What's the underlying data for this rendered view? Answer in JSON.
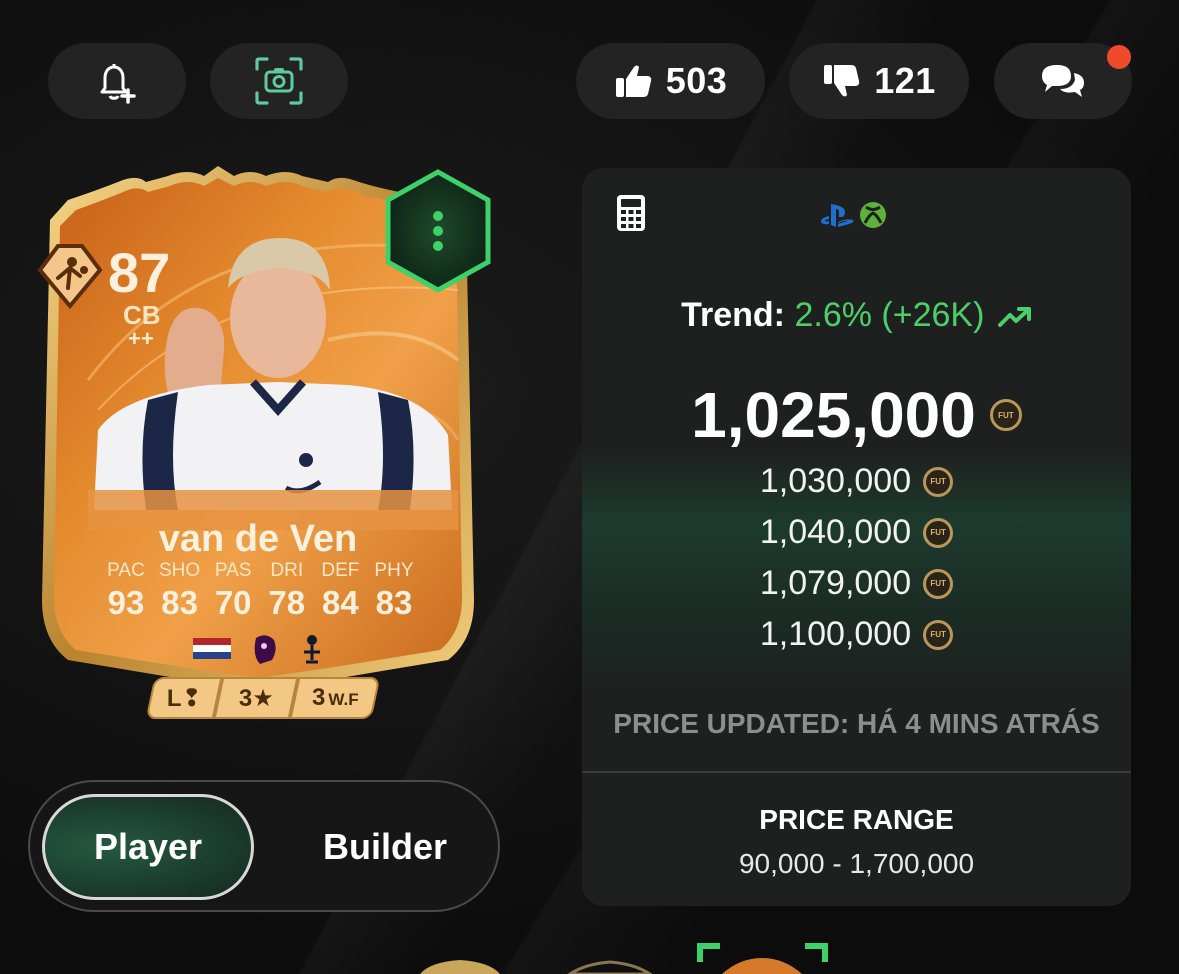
{
  "top_bar": {
    "likes": "503",
    "dislikes": "121",
    "icons": {
      "bell": "bell-plus-icon",
      "camera": "screenshot-camera-icon",
      "like": "thumbs-up-icon",
      "dislike": "thumbs-down-icon",
      "chat": "chat-bubbles-icon"
    },
    "notification_color": "#ef4a2a"
  },
  "card": {
    "rating": "87",
    "position": "CB",
    "position_plus": "++",
    "name": "van de Ven",
    "stat_labels": [
      "PAC",
      "SHO",
      "PAS",
      "DRI",
      "DEF",
      "PHY"
    ],
    "stat_values": [
      "93",
      "83",
      "70",
      "78",
      "84",
      "83"
    ],
    "foot": "L",
    "skill_moves": "3",
    "weak_foot": "3",
    "weak_foot_label": "W.F",
    "accent": "#e07b22",
    "menu_badge_color": "#3ed16a",
    "icons": [
      "role-badge-icon",
      "netherlands-flag-icon",
      "premier-league-icon",
      "tottenham-crest-icon",
      "more-vertical-icon"
    ]
  },
  "toggle": {
    "player_label": "Player",
    "builder_label": "Builder",
    "selected": "Player"
  },
  "price": {
    "trend_label": "Trend:",
    "trend_value": "2.6% (+26K)",
    "trend_color": "#4ccf6a",
    "current": "1,025,000",
    "listings": [
      "1,030,000",
      "1,040,000",
      "1,079,000",
      "1,100,000"
    ],
    "coin_label": "FUT",
    "updated": "PRICE UPDATED: HÁ 4 MINS ATRÁS",
    "range_title": "PRICE RANGE",
    "range_value": "90,000 - 1,700,000",
    "icons": [
      "calculator-icon",
      "playstation-icon",
      "xbox-icon",
      "trend-up-icon"
    ]
  }
}
